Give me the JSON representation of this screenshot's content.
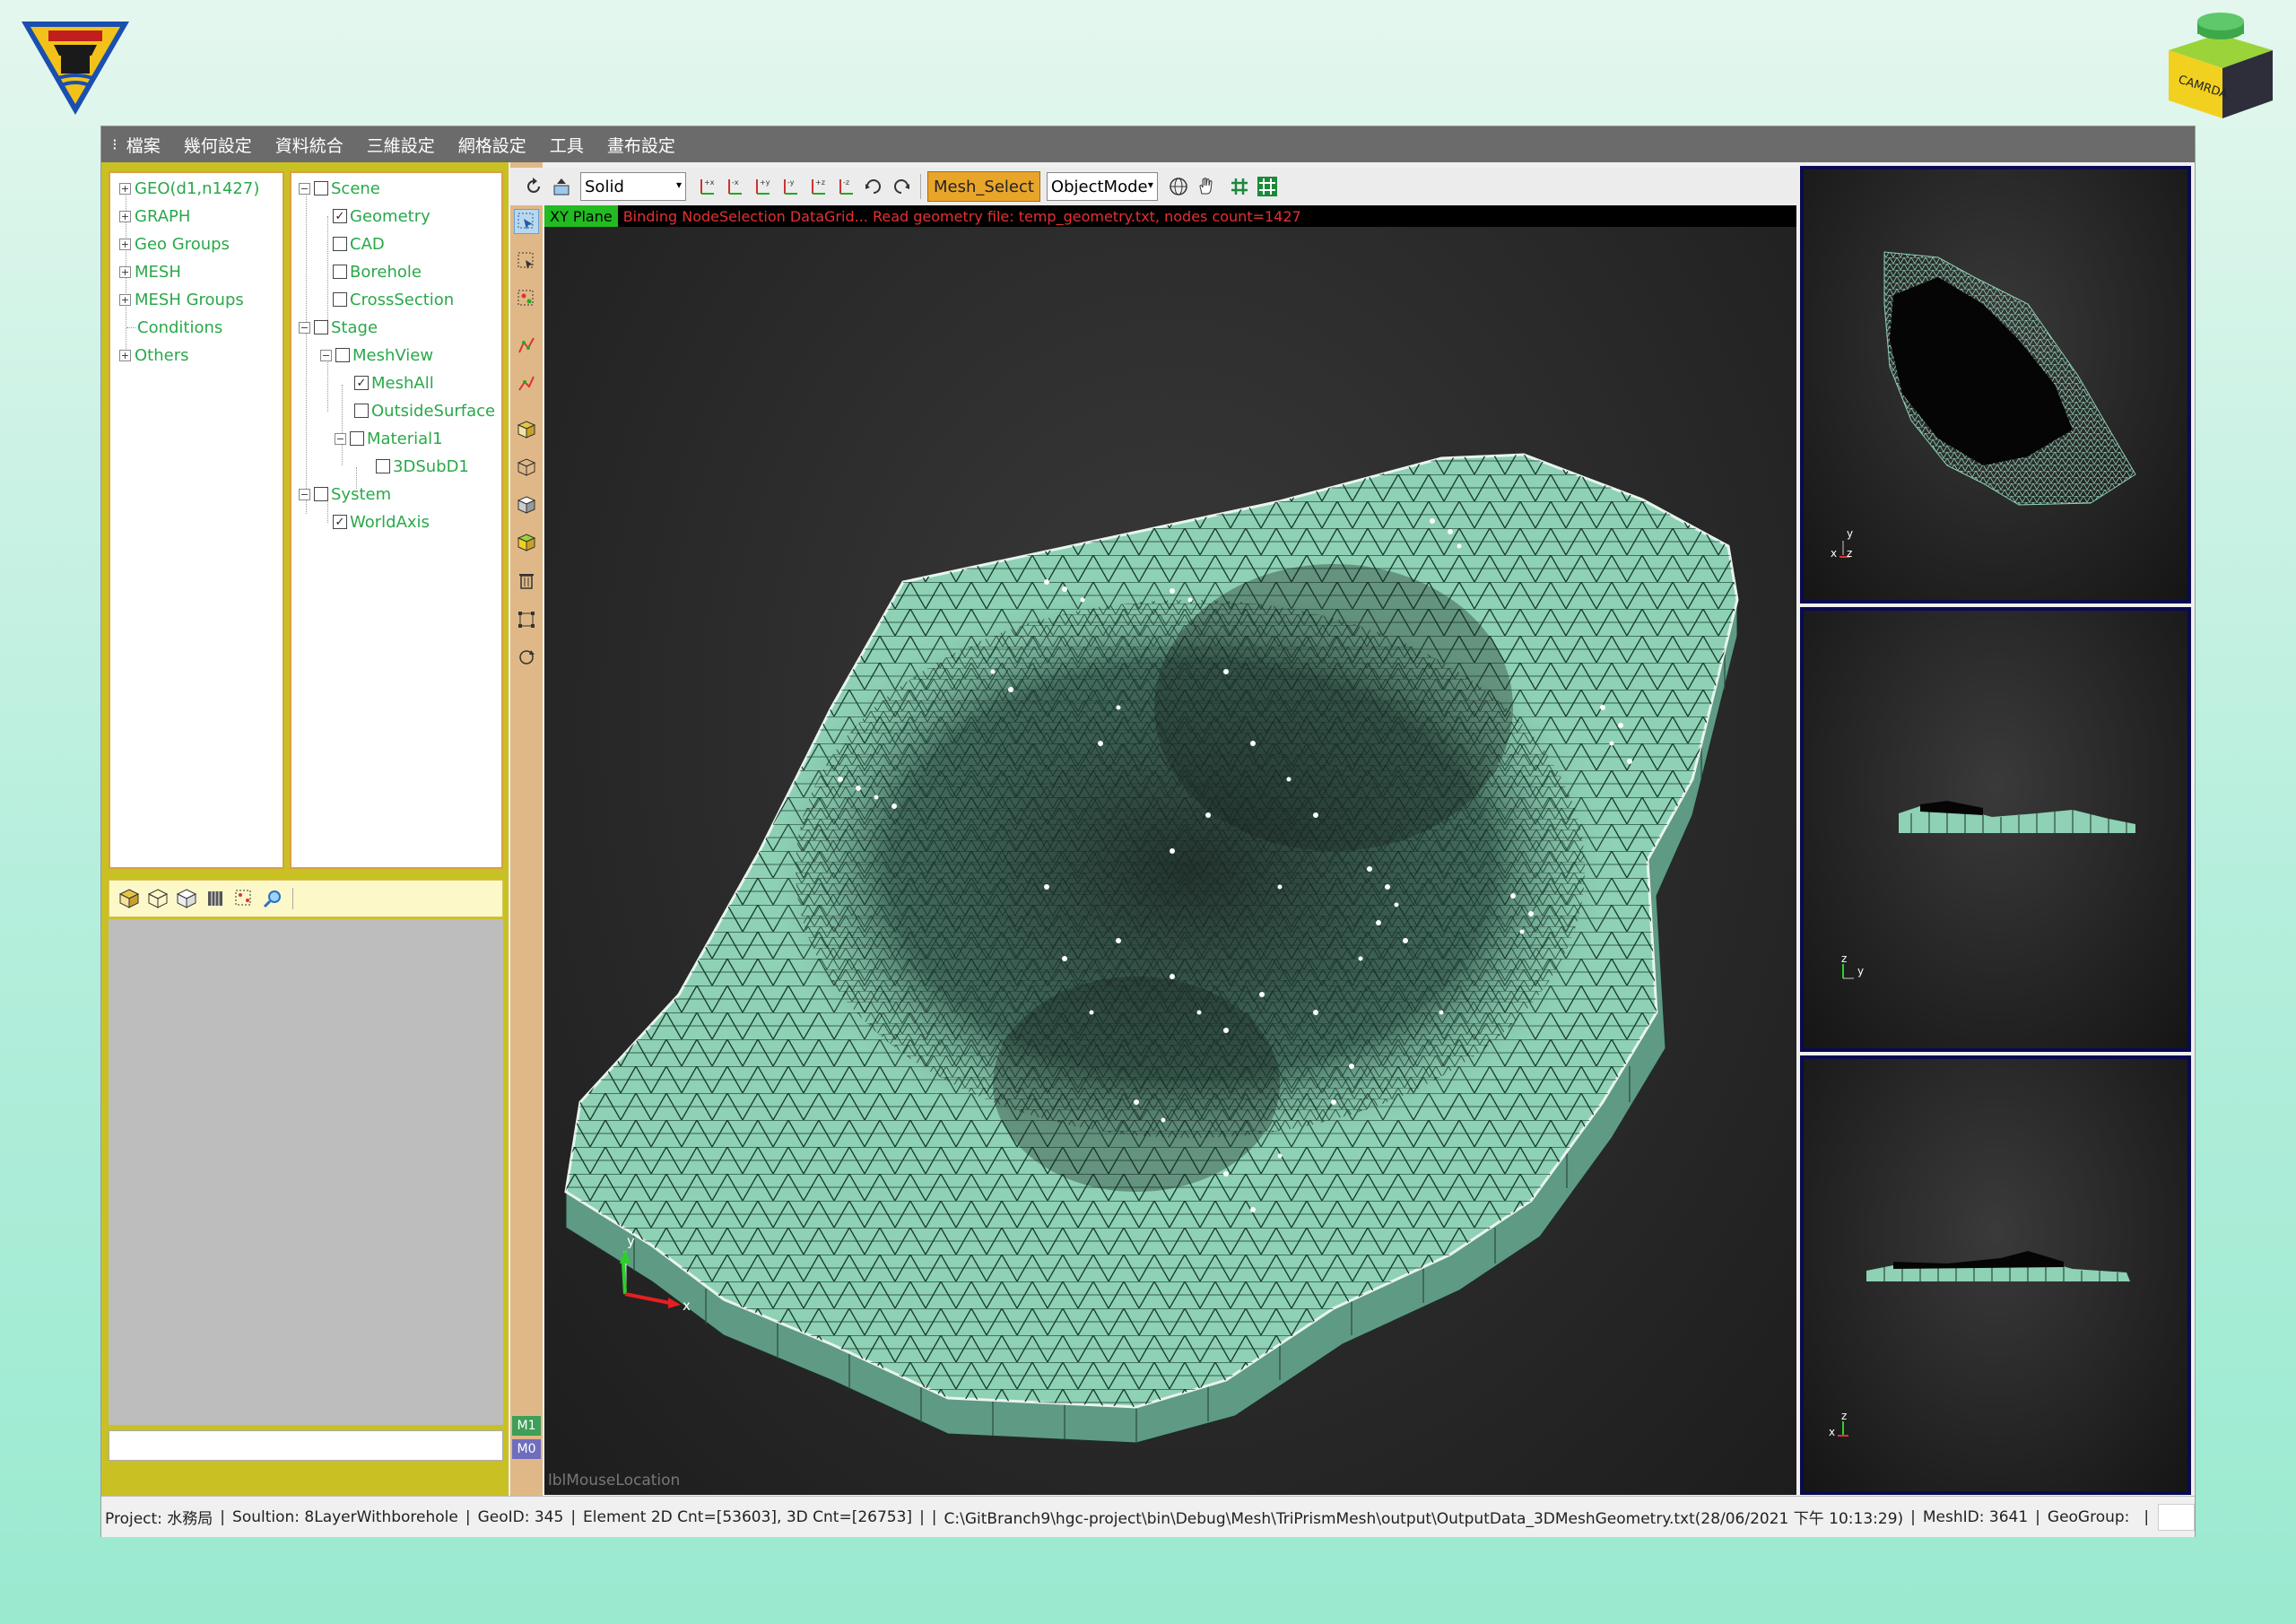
{
  "logos": {
    "left": "國立中央大學 seal",
    "right": "CAMRDA"
  },
  "menu": [
    "檔案",
    "幾何設定",
    "資料統合",
    "三維設定",
    "網格設定",
    "工具",
    "畫布設定"
  ],
  "tree_left": [
    "GEO(d1,n1427)",
    "GRAPH",
    "Geo Groups",
    "MESH",
    "MESH Groups",
    "Conditions",
    "Others"
  ],
  "tree_scene": {
    "scene": "Scene",
    "geometry": "Geometry",
    "cad": "CAD",
    "borehole": "Borehole",
    "crosssection": "CrossSection",
    "stage": "Stage",
    "meshview": "MeshView",
    "meshall": "MeshAll",
    "outsidesurface": "OutsideSurface",
    "material1": "Material1",
    "subd": "3DSubD1",
    "system": "System",
    "worldaxis": "WorldAxis"
  },
  "toolbar": {
    "render_mode": "Solid",
    "mesh_select": "Mesh_Select",
    "object_mode": "ObjectMode"
  },
  "viewport": {
    "plane": "XY Plane",
    "message": "Binding NodeSelection DataGrid... Read geometry file: temp_geometry.txt, nodes count=1427",
    "mouse_location": "lblMouseLocation",
    "axis_x": "x",
    "axis_y": "y",
    "axis_z": "z"
  },
  "vtool": {
    "m1": "M1",
    "m0": "M0"
  },
  "status": {
    "project": "Project:  水務局",
    "solution": "Soultion:  8LayerWithborehole",
    "geoid": "GeoID:  345",
    "element": "Element 2D Cnt=[53603], 3D Cnt=[26753]",
    "path": "C:\\GitBranch9\\hgc-project\\bin\\Debug\\Mesh\\TriPrismMesh\\output\\OutputData_3DMeshGeometry.txt(28/06/2021 下午 10:13:29)",
    "meshid": "MeshID:  3641",
    "geogroup": "GeoGroup:"
  },
  "colors": {
    "mesh": "#8ed1b4",
    "accent": "#e9a52a",
    "menubar": "#6b6b6b",
    "tree_text": "#2aa84a"
  }
}
